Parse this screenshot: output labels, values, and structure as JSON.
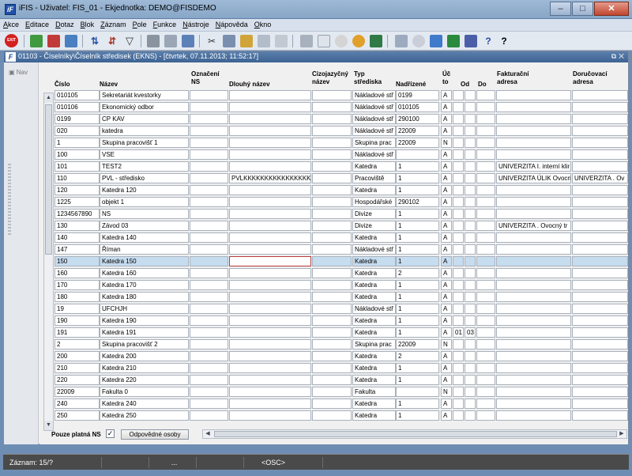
{
  "window": {
    "title": "iFIS - Uživatel: FIS_01 - Ekjednotka: DEMO@FISDEMO",
    "app_icon": "iF"
  },
  "menu": [
    "Akce",
    "Editace",
    "Dotaz",
    "Blok",
    "Záznam",
    "Pole",
    "Funkce",
    "Nástroje",
    "Nápověda",
    "Okno"
  ],
  "toolbar": {
    "exit_label": "EXIT"
  },
  "form": {
    "title": "01103 - Číselníky\\Číselník středisek (EKNS) - [čtvrtek, 07.11.2013; 11:52:17]",
    "icon": "F",
    "nav_label": "Nav"
  },
  "headers": {
    "cislo": "Číslo",
    "nazev": "Název",
    "oznaceni_1": "Označení",
    "oznaceni_2": "NS",
    "dlouhy": "Dlouhý název",
    "cizo_1": "Cizojazyčný",
    "cizo_2": "název",
    "typ_1": "Typ",
    "typ_2": "střediska",
    "nadrizene": "Nadřízené",
    "uc_1": "Úč",
    "uc_2": "to",
    "od": "Od",
    "do": "Do",
    "fakt_1": "Fakturační",
    "fakt_2": "adresa",
    "dor_1": "Doručovací",
    "dor_2": "adresa"
  },
  "rows": [
    {
      "cislo": "010105",
      "nazev": "Sekretariát kvestorky",
      "ozn": "",
      "dlouhy": "",
      "cizo": "",
      "typ": "Nákladové stř",
      "nadr": "0199",
      "uc": "A",
      "od": "",
      "do": "",
      "x": "",
      "fakt": "",
      "dor": ""
    },
    {
      "cislo": "010106",
      "nazev": "Ekonomický odbor",
      "ozn": "",
      "dlouhy": "",
      "cizo": "",
      "typ": "Nákladové stř",
      "nadr": "010105",
      "uc": "A",
      "od": "",
      "do": "",
      "x": "",
      "fakt": "",
      "dor": ""
    },
    {
      "cislo": "0199",
      "nazev": "CP KAV",
      "ozn": "",
      "dlouhy": "",
      "cizo": "",
      "typ": "Nákladové stř",
      "nadr": "290100",
      "uc": "A",
      "od": "",
      "do": "",
      "x": "",
      "fakt": "",
      "dor": ""
    },
    {
      "cislo": "020",
      "nazev": "katedra",
      "ozn": "",
      "dlouhy": "",
      "cizo": "",
      "typ": "Nákladové stř",
      "nadr": "22009",
      "uc": "A",
      "od": "",
      "do": "",
      "x": "",
      "fakt": "",
      "dor": ""
    },
    {
      "cislo": "1",
      "nazev": "Skupina pracovišť 1",
      "ozn": "",
      "dlouhy": "",
      "cizo": "",
      "typ": "Skupina prac",
      "nadr": "22009",
      "uc": "N",
      "od": "",
      "do": "",
      "x": "",
      "fakt": "",
      "dor": ""
    },
    {
      "cislo": "100",
      "nazev": "VSE",
      "ozn": "",
      "dlouhy": "",
      "cizo": "",
      "typ": "Nákladové stř",
      "nadr": "",
      "uc": "A",
      "od": "",
      "do": "",
      "x": "",
      "fakt": "",
      "dor": ""
    },
    {
      "cislo": "101",
      "nazev": "TEST2",
      "ozn": "",
      "dlouhy": "",
      "cizo": "",
      "typ": "Katedra",
      "nadr": "1",
      "uc": "A",
      "od": "",
      "do": "",
      "x": "",
      "fakt": "UNIVERZITA  I. interní klir",
      "dor": ""
    },
    {
      "cislo": "110",
      "nazev": "PVL - středisko",
      "ozn": "",
      "dlouhy": "PVLKKKKKKKKKKKKKKKK",
      "cizo": "",
      "typ": "Pracoviště",
      "nadr": "1",
      "uc": "A",
      "od": "",
      "do": "",
      "x": "",
      "fakt": "UNIVERZITA ÚLIK Ovocn",
      "dor": "UNIVERZITA . Ov"
    },
    {
      "cislo": "120",
      "nazev": "Katedra 120",
      "ozn": "",
      "dlouhy": "",
      "cizo": "",
      "typ": "Katedra",
      "nadr": "1",
      "uc": "A",
      "od": "",
      "do": "",
      "x": "",
      "fakt": "",
      "dor": ""
    },
    {
      "cislo": "1225",
      "nazev": "objekt 1",
      "ozn": "",
      "dlouhy": "",
      "cizo": "",
      "typ": "Hospodářské",
      "nadr": "290102",
      "uc": "A",
      "od": "",
      "do": "",
      "x": "",
      "fakt": "",
      "dor": ""
    },
    {
      "cislo": "1234567890",
      "nazev": "NS",
      "ozn": "",
      "dlouhy": "",
      "cizo": "",
      "typ": "Divize",
      "nadr": "1",
      "uc": "A",
      "od": "",
      "do": "",
      "x": "",
      "fakt": "",
      "dor": ""
    },
    {
      "cislo": "130",
      "nazev": "Závod 03",
      "ozn": "",
      "dlouhy": "",
      "cizo": "",
      "typ": "Divize",
      "nadr": "1",
      "uc": "A",
      "od": "",
      "do": "",
      "x": "",
      "fakt": "UNIVERZITA . Ovocný tr",
      "dor": ""
    },
    {
      "cislo": "140",
      "nazev": "Katedra 140",
      "ozn": "",
      "dlouhy": "",
      "cizo": "",
      "typ": "Katedra",
      "nadr": "1",
      "uc": "A",
      "od": "",
      "do": "",
      "x": "",
      "fakt": "",
      "dor": ""
    },
    {
      "cislo": "147",
      "nazev": "Říman",
      "ozn": "",
      "dlouhy": "",
      "cizo": "",
      "typ": "Nákladové stř",
      "nadr": "1",
      "uc": "A",
      "od": "",
      "do": "",
      "x": "",
      "fakt": "",
      "dor": ""
    },
    {
      "cislo": "150",
      "nazev": "Katedra 150",
      "ozn": "",
      "dlouhy": "",
      "cizo": "",
      "typ": "Katedra",
      "nadr": "1",
      "uc": "A",
      "od": "",
      "do": "",
      "x": "",
      "fakt": "",
      "dor": "",
      "selected": true
    },
    {
      "cislo": "160",
      "nazev": "Katedra 160",
      "ozn": "",
      "dlouhy": "",
      "cizo": "",
      "typ": "Katedra",
      "nadr": "2",
      "uc": "A",
      "od": "",
      "do": "",
      "x": "",
      "fakt": "",
      "dor": ""
    },
    {
      "cislo": "170",
      "nazev": "Katedra 170",
      "ozn": "",
      "dlouhy": "",
      "cizo": "",
      "typ": "Katedra",
      "nadr": "1",
      "uc": "A",
      "od": "",
      "do": "",
      "x": "",
      "fakt": "",
      "dor": ""
    },
    {
      "cislo": "180",
      "nazev": "Katedra 180",
      "ozn": "",
      "dlouhy": "",
      "cizo": "",
      "typ": "Katedra",
      "nadr": "1",
      "uc": "A",
      "od": "",
      "do": "",
      "x": "",
      "fakt": "",
      "dor": ""
    },
    {
      "cislo": "19",
      "nazev": "UFCHJH",
      "ozn": "",
      "dlouhy": "",
      "cizo": "",
      "typ": "Nákladové stř",
      "nadr": "1",
      "uc": "A",
      "od": "",
      "do": "",
      "x": "",
      "fakt": "",
      "dor": ""
    },
    {
      "cislo": "190",
      "nazev": "Katedra 190",
      "ozn": "",
      "dlouhy": "",
      "cizo": "",
      "typ": "Katedra",
      "nadr": "1",
      "uc": "A",
      "od": "",
      "do": "",
      "x": "",
      "fakt": "",
      "dor": ""
    },
    {
      "cislo": "191",
      "nazev": "Katedra 191",
      "ozn": "",
      "dlouhy": "",
      "cizo": "",
      "typ": "Katedra",
      "nadr": "1",
      "uc": "A",
      "od": "01",
      "do": "03",
      "x": "",
      "fakt": "",
      "dor": ""
    },
    {
      "cislo": "2",
      "nazev": "Skupina pracovišť 2",
      "ozn": "",
      "dlouhy": "",
      "cizo": "",
      "typ": "Skupina prac",
      "nadr": "22009",
      "uc": "N",
      "od": "",
      "do": "",
      "x": "",
      "fakt": "",
      "dor": ""
    },
    {
      "cislo": "200",
      "nazev": "Katedra 200",
      "ozn": "",
      "dlouhy": "",
      "cizo": "",
      "typ": "Katedra",
      "nadr": "2",
      "uc": "A",
      "od": "",
      "do": "",
      "x": "",
      "fakt": "",
      "dor": ""
    },
    {
      "cislo": "210",
      "nazev": "Katedra 210",
      "ozn": "",
      "dlouhy": "",
      "cizo": "",
      "typ": "Katedra",
      "nadr": "1",
      "uc": "A",
      "od": "",
      "do": "",
      "x": "",
      "fakt": "",
      "dor": ""
    },
    {
      "cislo": "220",
      "nazev": "Katedra 220",
      "ozn": "",
      "dlouhy": "",
      "cizo": "",
      "typ": "Katedra",
      "nadr": "1",
      "uc": "A",
      "od": "",
      "do": "",
      "x": "",
      "fakt": "",
      "dor": ""
    },
    {
      "cislo": "22009",
      "nazev": "Fakulta 0",
      "ozn": "",
      "dlouhy": "",
      "cizo": "",
      "typ": "Fakulta",
      "nadr": "",
      "uc": "N",
      "od": "",
      "do": "",
      "x": "",
      "fakt": "",
      "dor": ""
    },
    {
      "cislo": "240",
      "nazev": "Katedra 240",
      "ozn": "",
      "dlouhy": "",
      "cizo": "",
      "typ": "Katedra",
      "nadr": "1",
      "uc": "A",
      "od": "",
      "do": "",
      "x": "",
      "fakt": "",
      "dor": ""
    },
    {
      "cislo": "250",
      "nazev": "Katedra 250",
      "ozn": "",
      "dlouhy": "",
      "cizo": "",
      "typ": "Katedra",
      "nadr": "1",
      "uc": "A",
      "od": "",
      "do": "",
      "x": "",
      "fakt": "",
      "dor": ""
    }
  ],
  "footer": {
    "filter_label": "Pouze platná NS",
    "checkbox_mark": "✓",
    "button_label": "Odpovědné osoby"
  },
  "status": {
    "record": "Záznam: 15/?",
    "dots": "...",
    "mode": "<OSC>"
  }
}
